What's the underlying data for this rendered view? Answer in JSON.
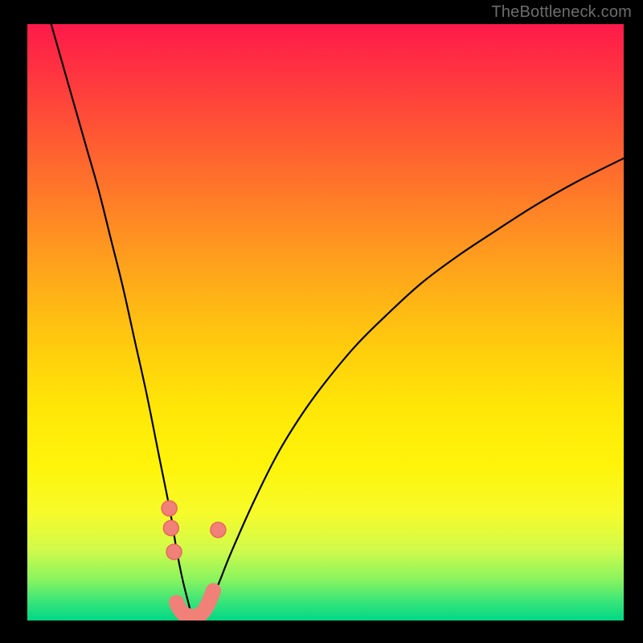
{
  "watermark": "TheBottleneck.com",
  "colors": {
    "background_frame": "#000000",
    "gradient_top": "#ff1a4a",
    "gradient_bottom": "#00d884",
    "curve": "#000000",
    "bottleneck_marker": "#f08078"
  },
  "chart_data": {
    "type": "line",
    "title": "",
    "xlabel": "",
    "ylabel": "",
    "xlim": [
      0,
      100
    ],
    "ylim": [
      0,
      100
    ],
    "legend": false,
    "grid": false,
    "series": [
      {
        "name": "bottleneck-curve",
        "x": [
          4,
          6,
          8,
          10,
          12,
          14,
          16,
          18,
          20,
          22,
          24,
          25,
          26,
          27,
          27.7,
          28.5,
          30,
          32,
          34,
          38,
          42,
          46,
          50,
          55,
          60,
          66,
          72,
          78,
          85,
          92,
          100
        ],
        "y": [
          100,
          93,
          86,
          79,
          72,
          64,
          56,
          47,
          38,
          28,
          18,
          12,
          7,
          3,
          0.5,
          0.5,
          2,
          6,
          11,
          20,
          28,
          34.5,
          40,
          46,
          51,
          56.5,
          61,
          65,
          69.5,
          73.5,
          77.5
        ]
      }
    ],
    "bottleneck_markers": {
      "note": "approximate positions of salmon-colored markers near the curve minimum",
      "points": [
        {
          "x": 23.8,
          "y": 18.8
        },
        {
          "x": 24.1,
          "y": 15.5
        },
        {
          "x": 24.6,
          "y": 11.5
        },
        {
          "x": 32.0,
          "y": 15.2
        }
      ],
      "band": [
        {
          "x": 25.0,
          "y": 3.0
        },
        {
          "x": 26.0,
          "y": 1.3
        },
        {
          "x": 27.5,
          "y": 0.7
        },
        {
          "x": 29.0,
          "y": 1.0
        },
        {
          "x": 30.2,
          "y": 2.6
        },
        {
          "x": 31.2,
          "y": 5.0
        }
      ]
    }
  }
}
